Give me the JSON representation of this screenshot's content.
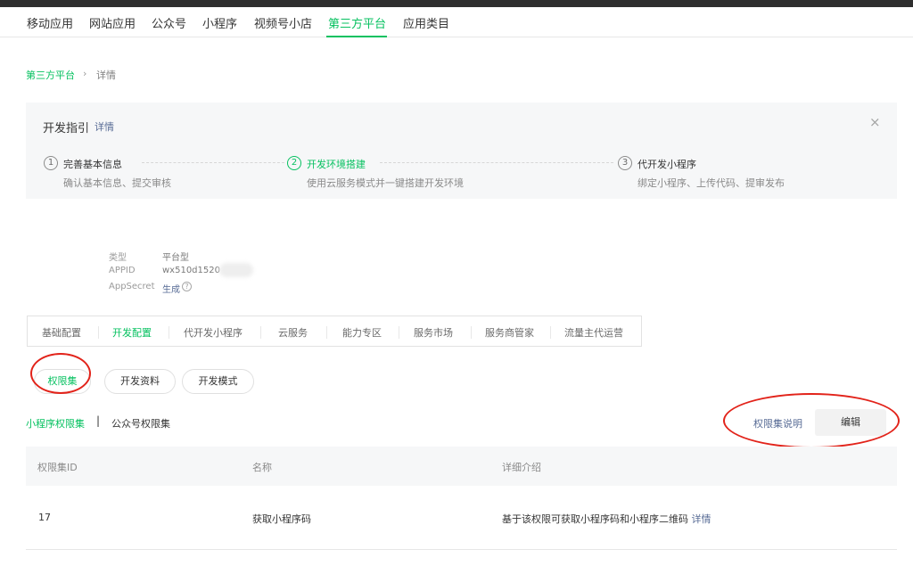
{
  "nav": {
    "items": [
      "移动应用",
      "网站应用",
      "公众号",
      "小程序",
      "视频号小店",
      "第三方平台",
      "应用类目"
    ],
    "active_index": 5
  },
  "breadcrumb": {
    "parent": "第三方平台",
    "separator": "›",
    "current": "详情"
  },
  "guide": {
    "title": "开发指引",
    "detail_link": "详情",
    "close": "×",
    "steps": [
      {
        "num": "1",
        "title": "完善基本信息",
        "desc": "确认基本信息、提交审核"
      },
      {
        "num": "2",
        "title": "开发环境搭建",
        "desc": "使用云服务模式并一键搭建开发环境"
      },
      {
        "num": "3",
        "title": "代开发小程序",
        "desc": "绑定小程序、上传代码、提审发布"
      }
    ],
    "active_step": 2
  },
  "info": {
    "type_label": "类型",
    "type_value": "平台型",
    "appid_label": "APPID",
    "appid_value": "wx510d1520",
    "secret_label": "AppSecret",
    "secret_value": "生成",
    "help_glyph": "?"
  },
  "tabs": [
    "基础配置",
    "开发配置",
    "代开发小程序",
    "云服务",
    "能力专区",
    "服务市场",
    "服务商管家",
    "流量主代运营"
  ],
  "active_tab": 1,
  "pills": [
    "权限集",
    "开发资料",
    "开发模式"
  ],
  "active_pill": 0,
  "subtabs": {
    "items": [
      "小程序权限集",
      "公众号权限集"
    ],
    "separator": "|",
    "active_index": 0
  },
  "actions": {
    "help_label": "权限集说明",
    "edit_label": "编辑"
  },
  "table": {
    "headers": [
      "权限集ID",
      "名称",
      "详细介绍"
    ],
    "rows": [
      {
        "id": "17",
        "name": "获取小程序码",
        "desc": "基于该权限可获取小程序码和小程序二维码",
        "link": "详情"
      }
    ]
  },
  "colors": {
    "accent": "#07c160",
    "link": "#576b95",
    "annotation": "#e2231a",
    "topbar": "#2e2e2e"
  }
}
